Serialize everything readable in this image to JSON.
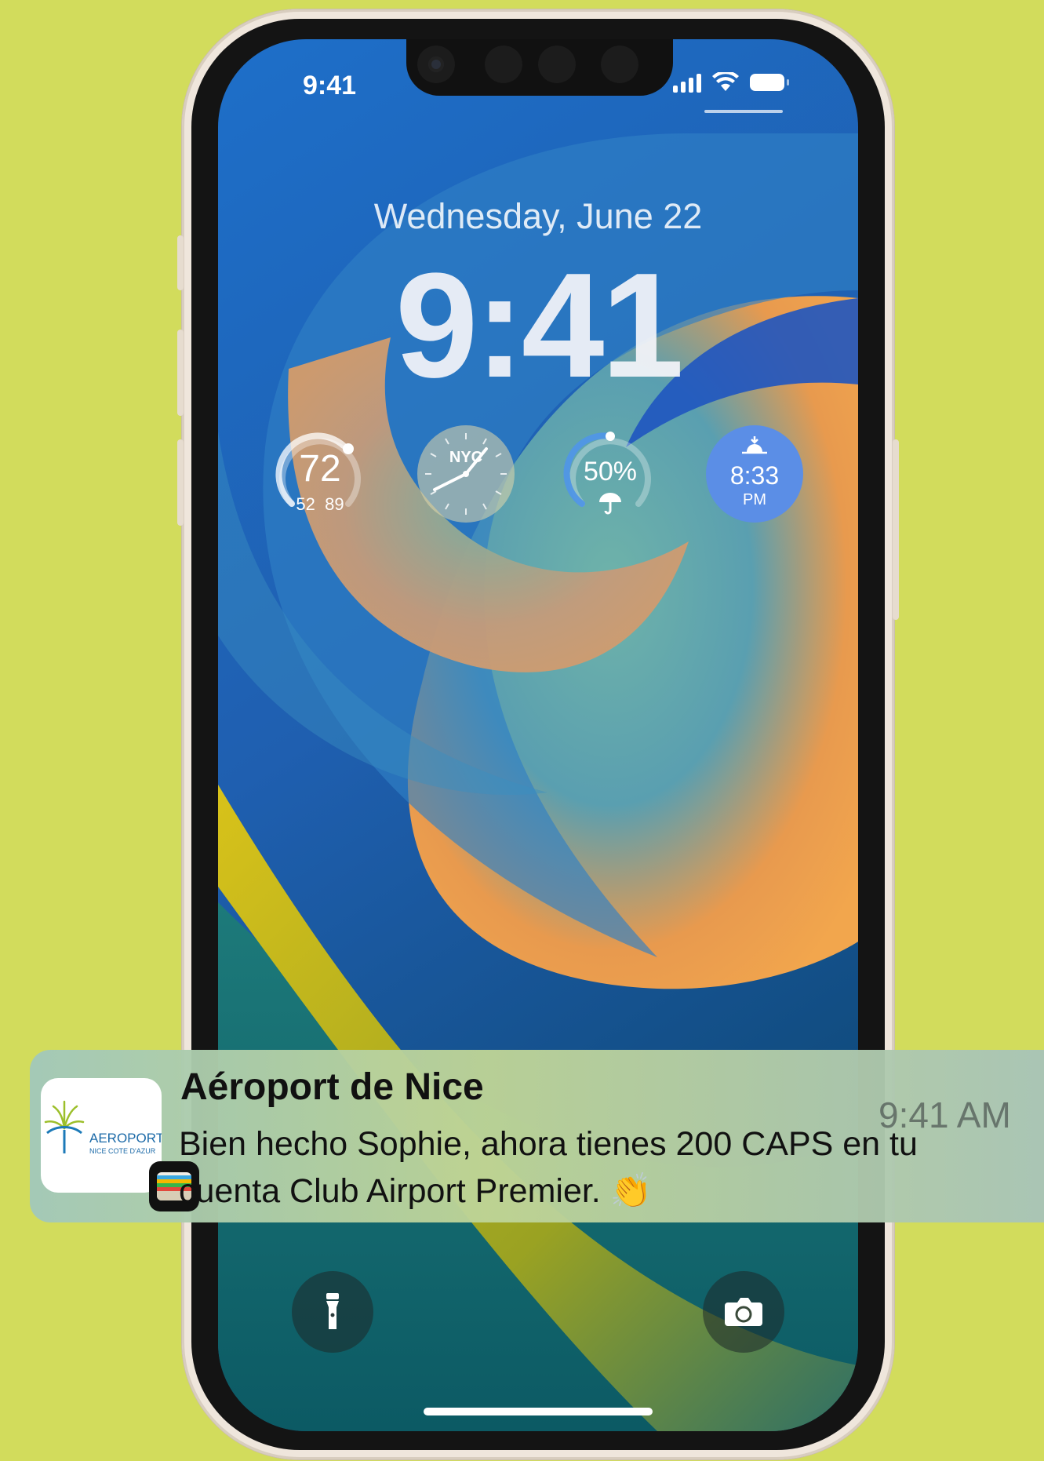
{
  "status_bar": {
    "time": "9:41"
  },
  "lock_screen": {
    "date": "Wednesday, June 22",
    "time": "9:41",
    "widgets": {
      "weather": {
        "temp": "72",
        "low_high": "52  89"
      },
      "world_clock": {
        "city": "NYC"
      },
      "rain_chance": {
        "value": "50%"
      },
      "sunset": {
        "time": "8:33",
        "period": "PM"
      }
    },
    "quick_actions": {
      "left": "flashlight-icon",
      "right": "camera-icon"
    }
  },
  "notification": {
    "title": "Aéroport de Nice",
    "time": "9:41 AM",
    "body": "Bien hecho Sophie, ahora tienes 200 CAPS en tu cuenta Club Airport Premier.",
    "emoji": "👏",
    "app_icon_text": "AEROPORT",
    "app_icon_subtext": "NICE COTE D'AZUR",
    "badge_icon": "wallet-icon"
  },
  "colors": {
    "background": "#d2dc5c",
    "phone_frame": "#efe6dc",
    "sunset_widget": "#5b8ee6"
  }
}
